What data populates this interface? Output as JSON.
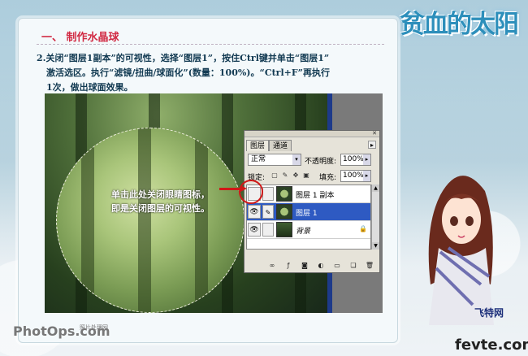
{
  "section_title": "一、 制作水晶球",
  "instruction_lines": [
    "2.关闭“图层1副本”的可视性，选择“图层1”，按住Ctrl键并单击“图层1”",
    "激活选区。执行“滤镜/扭曲/球面化”(数量：100%)。“Ctrl+F”再执行",
    "1次，做出球面效果。"
  ],
  "annotation_lines": [
    "单击此处关闭眼睛图标，",
    "即是关闭图层的可视性。"
  ],
  "layers_panel": {
    "tabs": [
      "图层",
      "通道"
    ],
    "blend_mode": "正常",
    "opacity_label": "不透明度:",
    "opacity_value": "100%",
    "lock_label": "锁定:",
    "fill_label": "填充:",
    "fill_value": "100%",
    "layers": [
      {
        "name": "图层 1 副本",
        "visible": false,
        "selected": false
      },
      {
        "name": "图层 1",
        "visible": true,
        "selected": true
      },
      {
        "name": "背景",
        "visible": true,
        "selected": false,
        "locked": true
      }
    ]
  },
  "watermark": {
    "logo": "PhotOps.com",
    "tag": "照片处理网"
  },
  "decor": {
    "logo_title": "贫血的太阳",
    "brand_cn": "飞特网",
    "site": "fevte.com"
  },
  "colors": {
    "section_title": "#d12a43",
    "body_text": "#123a52",
    "selection_blue": "#2e5ac2",
    "highlight_red": "#d01818"
  }
}
